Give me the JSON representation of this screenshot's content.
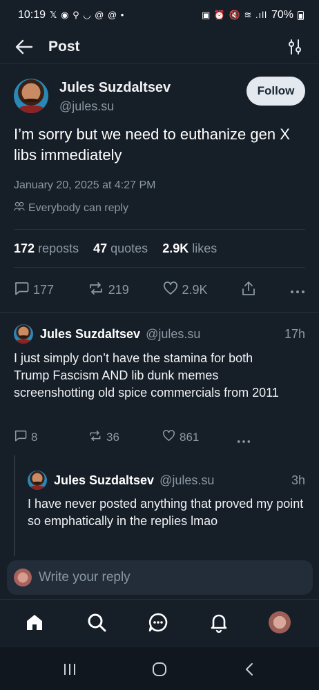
{
  "status_bar": {
    "time": "10:19",
    "left_icons": "𝕏 ◉ ⚲ ◡ @ @ •",
    "right_icons": "▣ ⏰ 🔇 ≋ .ıll",
    "battery": "70%"
  },
  "header": {
    "title": "Post"
  },
  "post": {
    "author_name": "Jules Suzdaltsev",
    "author_handle": "@jules.su",
    "follow_label": "Follow",
    "text": "I’m sorry but we need to euthanize gen X libs immediately",
    "date": "January 20, 2025 at 4:27 PM",
    "reply_setting": "Everybody can reply",
    "stats": {
      "reposts_count": "172",
      "reposts_label": "reposts",
      "quotes_count": "47",
      "quotes_label": "quotes",
      "likes_count": "2.9K",
      "likes_label": "likes"
    },
    "actions": {
      "replies": "177",
      "reposts": "219",
      "likes": "2.9K"
    }
  },
  "replies": [
    {
      "author_name": "Jules Suzdaltsev",
      "author_handle": "@jules.su",
      "time": "17h",
      "text": "I just simply don’t have the stamina for both Trump Fascism AND lib dunk memes screenshotting old spice commercials from 2011",
      "replies": "8",
      "reposts": "36",
      "likes": "861"
    },
    {
      "author_name": "Jules Suzdaltsev",
      "author_handle": "@jules.su",
      "time": "3h",
      "text": "I have never posted anything that proved my point so emphatically in the replies lmao"
    }
  ],
  "composer": {
    "placeholder": "Write your reply"
  },
  "colors": {
    "background": "#161e27",
    "muted": "#8b98a5",
    "follow_bg": "#e3e9ee",
    "divider": "#27313c"
  },
  "icons": {
    "header": [
      "back-arrow-icon",
      "settings-sliders-icon"
    ],
    "tabs": [
      "home-icon",
      "search-icon",
      "chat-icon",
      "notifications-icon",
      "profile-avatar"
    ],
    "system_nav": [
      "recent-apps-icon",
      "home-circle-icon",
      "back-chevron-icon"
    ]
  }
}
